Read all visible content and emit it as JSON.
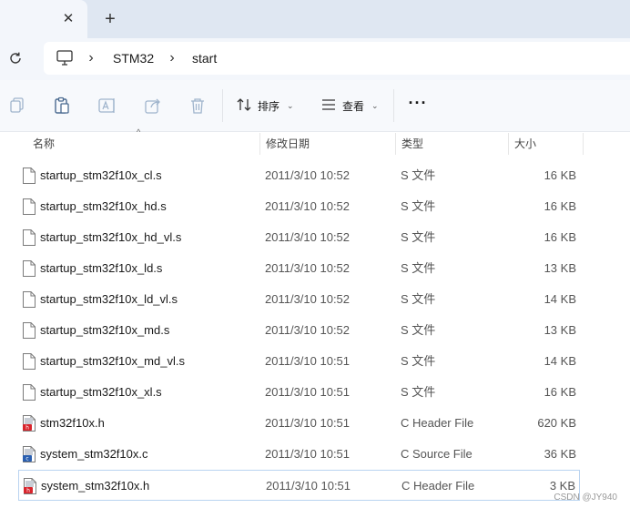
{
  "tabs": {
    "close_symbol": "✕",
    "new_tab_symbol": "+"
  },
  "breadcrumb": {
    "items": [
      "STM32",
      "start"
    ],
    "separator": "›"
  },
  "toolbar": {
    "sort_label": "排序",
    "view_label": "查看",
    "more_symbol": "···",
    "icons": [
      "copy-icon",
      "paste-icon",
      "rename-icon",
      "share-icon",
      "delete-icon"
    ]
  },
  "columns": {
    "name": "名称",
    "date": "修改日期",
    "type": "类型",
    "size": "大小"
  },
  "files": [
    {
      "name": "startup_stm32f10x_cl.s",
      "date": "2011/3/10 10:52",
      "type": "S 文件",
      "size": "16 KB",
      "icon": "s-file-icon"
    },
    {
      "name": "startup_stm32f10x_hd.s",
      "date": "2011/3/10 10:52",
      "type": "S 文件",
      "size": "16 KB",
      "icon": "s-file-icon"
    },
    {
      "name": "startup_stm32f10x_hd_vl.s",
      "date": "2011/3/10 10:52",
      "type": "S 文件",
      "size": "16 KB",
      "icon": "s-file-icon"
    },
    {
      "name": "startup_stm32f10x_ld.s",
      "date": "2011/3/10 10:52",
      "type": "S 文件",
      "size": "13 KB",
      "icon": "s-file-icon"
    },
    {
      "name": "startup_stm32f10x_ld_vl.s",
      "date": "2011/3/10 10:52",
      "type": "S 文件",
      "size": "14 KB",
      "icon": "s-file-icon"
    },
    {
      "name": "startup_stm32f10x_md.s",
      "date": "2011/3/10 10:52",
      "type": "S 文件",
      "size": "13 KB",
      "icon": "s-file-icon"
    },
    {
      "name": "startup_stm32f10x_md_vl.s",
      "date": "2011/3/10 10:51",
      "type": "S 文件",
      "size": "14 KB",
      "icon": "s-file-icon"
    },
    {
      "name": "startup_stm32f10x_xl.s",
      "date": "2011/3/10 10:51",
      "type": "S 文件",
      "size": "16 KB",
      "icon": "s-file-icon"
    },
    {
      "name": "stm32f10x.h",
      "date": "2011/3/10 10:51",
      "type": "C Header File",
      "size": "620 KB",
      "icon": "header-file-icon"
    },
    {
      "name": "system_stm32f10x.c",
      "date": "2011/3/10 10:51",
      "type": "C Source File",
      "size": "36 KB",
      "icon": "c-source-file-icon"
    },
    {
      "name": "system_stm32f10x.h",
      "date": "2011/3/10 10:51",
      "type": "C Header File",
      "size": "3 KB",
      "icon": "header-file-icon",
      "selected": true
    }
  ],
  "watermark": "CSDN @JY940",
  "colors": {
    "tabstrip_bg": "#dfe7f2",
    "selection_border": "#b9d3f0",
    "header_icon_red": "#d8242c",
    "source_icon_blue": "#2a5fb0"
  }
}
